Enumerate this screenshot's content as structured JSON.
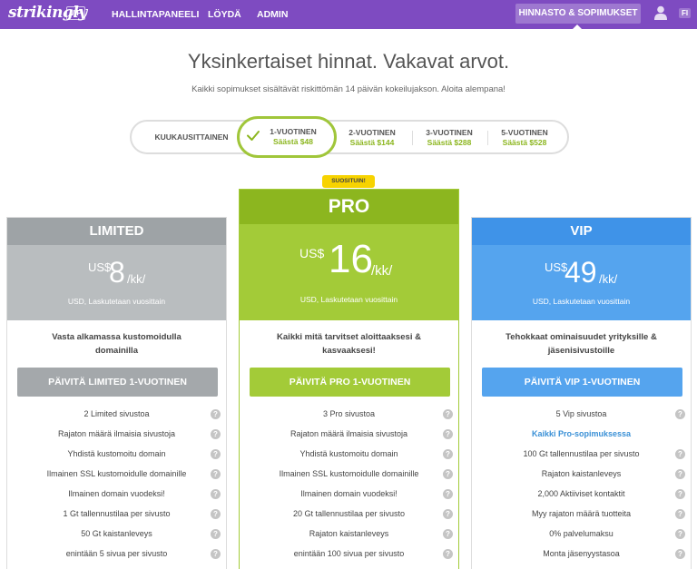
{
  "nav": {
    "logo": "strikingly",
    "vip_tag": "VIP",
    "links": [
      "HALLINTAPANEELI",
      "LÖYDÄ",
      "ADMIN"
    ],
    "active": "HINNASTO & SOPIMUKSET",
    "lang": "FI"
  },
  "header": {
    "title": "Yksinkertaiset hinnat. Vakavat arvot.",
    "subtitle": "Kaikki sopimukset sisältävät riskittömän 14 päivän kokeilujakson. Aloita alempana!"
  },
  "billing": {
    "options": [
      {
        "label": "KUUKAUSITTAINEN",
        "save": ""
      },
      {
        "label": "1-VUOTINEN",
        "save": "Säästä $48"
      },
      {
        "label": "2-VUOTINEN",
        "save": "Säästä $144"
      },
      {
        "label": "3-VUOTINEN",
        "save": "Säästä $288"
      },
      {
        "label": "5-VUOTINEN",
        "save": "Säästä $528"
      }
    ],
    "selected": "1-VUOTINEN"
  },
  "badge": "SUOSITUIN!",
  "plans": [
    {
      "name": "LIMITED",
      "currency": "US$",
      "price": "8",
      "unit": "/kk/",
      "note": "USD, Laskutetaan vuosittain",
      "tagline": "Vasta alkamassa kustomoidulla domainilla",
      "cta": "PÄIVITÄ LIMITED 1-VUOTINEN",
      "features": [
        "2 Limited sivustoa",
        "Rajaton määrä ilmaisia sivustoja",
        "Yhdistä kustomoitu domain",
        "Ilmainen SSL kustomoidulle domainille",
        "Ilmainen domain vuodeksi!",
        "1 Gt tallennustilaa per sivusto",
        "50 Gt kaistanleveys",
        "enintään 5 sivua per sivusto"
      ],
      "colors": {
        "head": "#9ea3a6",
        "price": "#b9bdbf",
        "cta": "#a4a8ab"
      }
    },
    {
      "name": "PRO",
      "currency": "US$",
      "price": "16",
      "unit": "/kk/",
      "note": "USD, Laskutetaan vuosittain",
      "tagline": "Kaikki mitä tarvitset aloittaaksesi & kasvaaksesi!",
      "cta": "PÄIVITÄ PRO 1-VUOTINEN",
      "features": [
        "3 Pro sivustoa",
        "Rajaton määrä ilmaisia sivustoja",
        "Yhdistä kustomoitu domain",
        "Ilmainen SSL kustomoidulle domainille",
        "Ilmainen domain vuodeksi!",
        "20 Gt tallennustilaa per sivusto",
        "Rajaton kaistanleveys",
        "enintään 100 sivua per sivusto"
      ],
      "colors": {
        "head": "#8cb61f",
        "price": "#a3cb38",
        "cta": "#a3cb38"
      }
    },
    {
      "name": "VIP",
      "currency": "US$",
      "price": "49",
      "unit": "/kk/",
      "note": "USD, Laskutetaan vuosittain",
      "tagline": "Tehokkaat ominaisuudet yrityksille & jäsenisivustoille",
      "cta": "PÄIVITÄ VIP 1-VUOTINEN",
      "features": [
        "5 Vip sivustoa",
        "Kaikki Pro-sopimuksessa",
        "100 Gt tallennustilaa per sivusto",
        "Rajaton kaistanleveys",
        "2,000 Aktiiviset kontaktit",
        "Myy rajaton määrä tuotteita",
        "0% palvelumaksu",
        "Monta jäsenyystasoa"
      ],
      "colors": {
        "head": "#3f93e8",
        "price": "#55a4ee",
        "cta": "#55a4ee"
      }
    }
  ],
  "help_glyph": "?"
}
